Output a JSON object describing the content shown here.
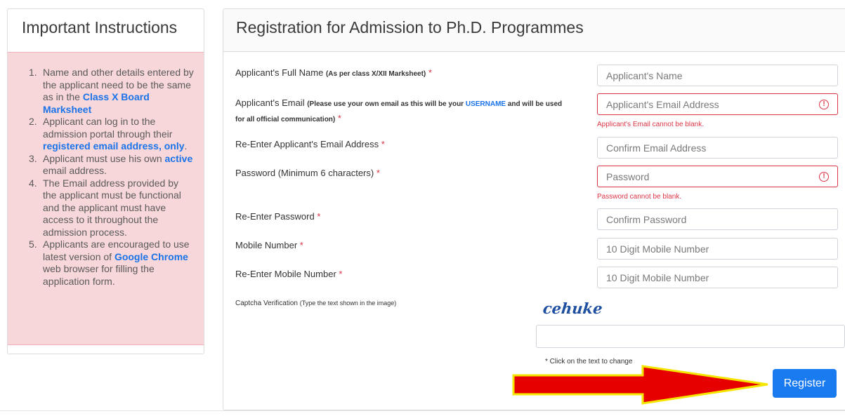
{
  "instructions": {
    "title": "Important Instructions",
    "items": [
      {
        "num": "1.",
        "before": "Name and other details entered by the applicant need to be the same as in the ",
        "highlight": "Class X Board Marksheet",
        "after": ""
      },
      {
        "num": "2.",
        "before": "Applicant can log in to the admission portal through their ",
        "highlight": "registered email address, only",
        "after": "."
      },
      {
        "num": "3.",
        "before": "Applicant must use his own ",
        "highlight": "active",
        "after": " email address."
      },
      {
        "num": "4.",
        "before": "The Email address provided by the applicant must be functional and the applicant must have access to it throughout the admission process.",
        "highlight": "",
        "after": ""
      },
      {
        "num": "5.",
        "before": "Applicants are encouraged to use latest version of ",
        "highlight": "Google Chrome",
        "after": " web browser for filling the application form."
      }
    ]
  },
  "form": {
    "title": "Registration for Admission to Ph.D. Programmes",
    "full_name_label": "Applicant's Full Name",
    "full_name_note": "(As per class X/XII Marksheet)",
    "full_name_placeholder": "Applicant's Name",
    "email_label": "Applicant's Email",
    "email_note_before": "(Please use your own email as this will be your ",
    "email_note_link": "USERNAME",
    "email_note_after": " and will be used for all official communication)",
    "email_placeholder": "Applicant's Email Address",
    "email_error": "Applicant's Email cannot be blank.",
    "confirm_email_label": "Re-Enter Applicant's Email Address",
    "confirm_email_placeholder": "Confirm Email Address",
    "password_label": "Password (Minimum 6 characters)",
    "password_placeholder": "Password",
    "password_error": "Password cannot be blank.",
    "confirm_password_label": "Re-Enter Password",
    "confirm_password_placeholder": "Confirm Password",
    "mobile_label": "Mobile Number",
    "mobile_placeholder": "10 Digit Mobile Number",
    "confirm_mobile_label": "Re-Enter Mobile Number",
    "confirm_mobile_placeholder": "10 Digit Mobile Number",
    "captcha_label": "Captcha Verification",
    "captcha_note": "(Type the text shown in the image)",
    "captcha_text": "cehuke",
    "captcha_hint": "* Click on the text to change",
    "required_mark": "*",
    "error_icon_glyph": "!",
    "register_label": "Register"
  },
  "colors": {
    "accent": "#1a7bf0",
    "error": "#dc3545",
    "instructions_bg": "#f8d7da",
    "arrow_fill": "#e60000",
    "arrow_outline": "#f5e600"
  },
  "icons": {
    "email_error": "exclamation-circle-icon",
    "password_error": "exclamation-circle-icon",
    "annotation": "red-arrow-icon"
  }
}
